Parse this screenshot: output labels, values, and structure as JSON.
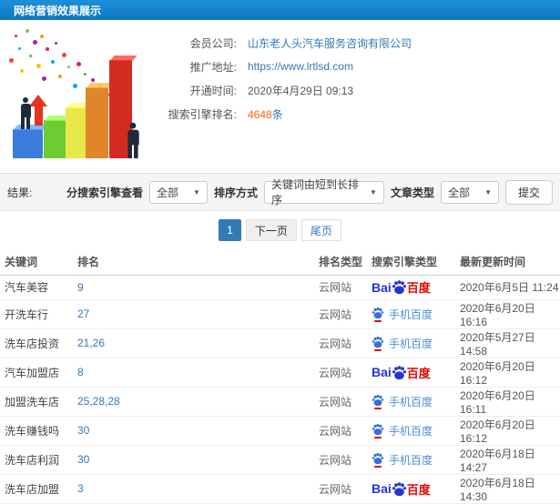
{
  "page": {
    "title": "网络营销效果展示"
  },
  "info": {
    "rows": [
      {
        "label": "会员公司:",
        "value": "山东老人头汽车服务咨询有限公司"
      },
      {
        "label": "推广地址:",
        "value": "https://www.lrtlsd.com"
      },
      {
        "label": "开通时间:",
        "value": "2020年4月29日 09:13"
      },
      {
        "label": "搜索引擎排名:",
        "value": "4648",
        "suffix": "条"
      }
    ]
  },
  "filters": {
    "result_label": "结果:",
    "engine_label": "分搜索引擎查看",
    "engine_value": "全部",
    "sort_label": "排序方式",
    "sort_value": "关键词由短到长排序",
    "article_label": "文章类型",
    "article_value": "全部",
    "submit_label": "提交",
    "caret": "▼"
  },
  "pagination": {
    "current": "1",
    "next": "下一页",
    "last": "尾页"
  },
  "table": {
    "headers": [
      "关键词",
      "排名",
      "排名类型",
      "搜索引擎类型",
      "最新更新时间"
    ],
    "rows": [
      {
        "keyword": "汽车美容",
        "rank": "9",
        "rank_type": "云网站",
        "engine": "baidu",
        "updated": "2020年6月5日 11:24"
      },
      {
        "keyword": "开洗车行",
        "rank": "27",
        "rank_type": "云网站",
        "engine": "mobile",
        "updated": "2020年6月20日 16:16"
      },
      {
        "keyword": "洗车店投资",
        "rank": "21,26",
        "rank_type": "云网站",
        "engine": "mobile",
        "updated": "2020年5月27日 14:58"
      },
      {
        "keyword": "汽车加盟店",
        "rank": "8",
        "rank_type": "云网站",
        "engine": "baidu",
        "updated": "2020年6月20日 16:12"
      },
      {
        "keyword": "加盟洗车店",
        "rank": "25,28,28",
        "rank_type": "云网站",
        "engine": "mobile",
        "updated": "2020年6月20日 16:11"
      },
      {
        "keyword": "洗车赚钱吗",
        "rank": "30",
        "rank_type": "云网站",
        "engine": "mobile",
        "updated": "2020年6月20日 16:12"
      },
      {
        "keyword": "洗车店利润",
        "rank": "30",
        "rank_type": "云网站",
        "engine": "mobile",
        "updated": "2020年6月18日 14:27"
      },
      {
        "keyword": "洗车店加盟",
        "rank": "3",
        "rank_type": "云网站",
        "engine": "baidu",
        "updated": "2020年6月18日 14:30"
      }
    ]
  },
  "engine_logos": {
    "baidu": {
      "prefix": "Bai",
      "suffix": "百度"
    },
    "mobile": {
      "label": "手机百度"
    }
  },
  "colors": {
    "header_blue": "#1789d0",
    "link_blue": "#337ab7",
    "highlight_orange": "#ff6600",
    "baidu_blue": "#2334d8",
    "baidu_red": "#e10602",
    "mobile_blue": "#4a90d9"
  }
}
